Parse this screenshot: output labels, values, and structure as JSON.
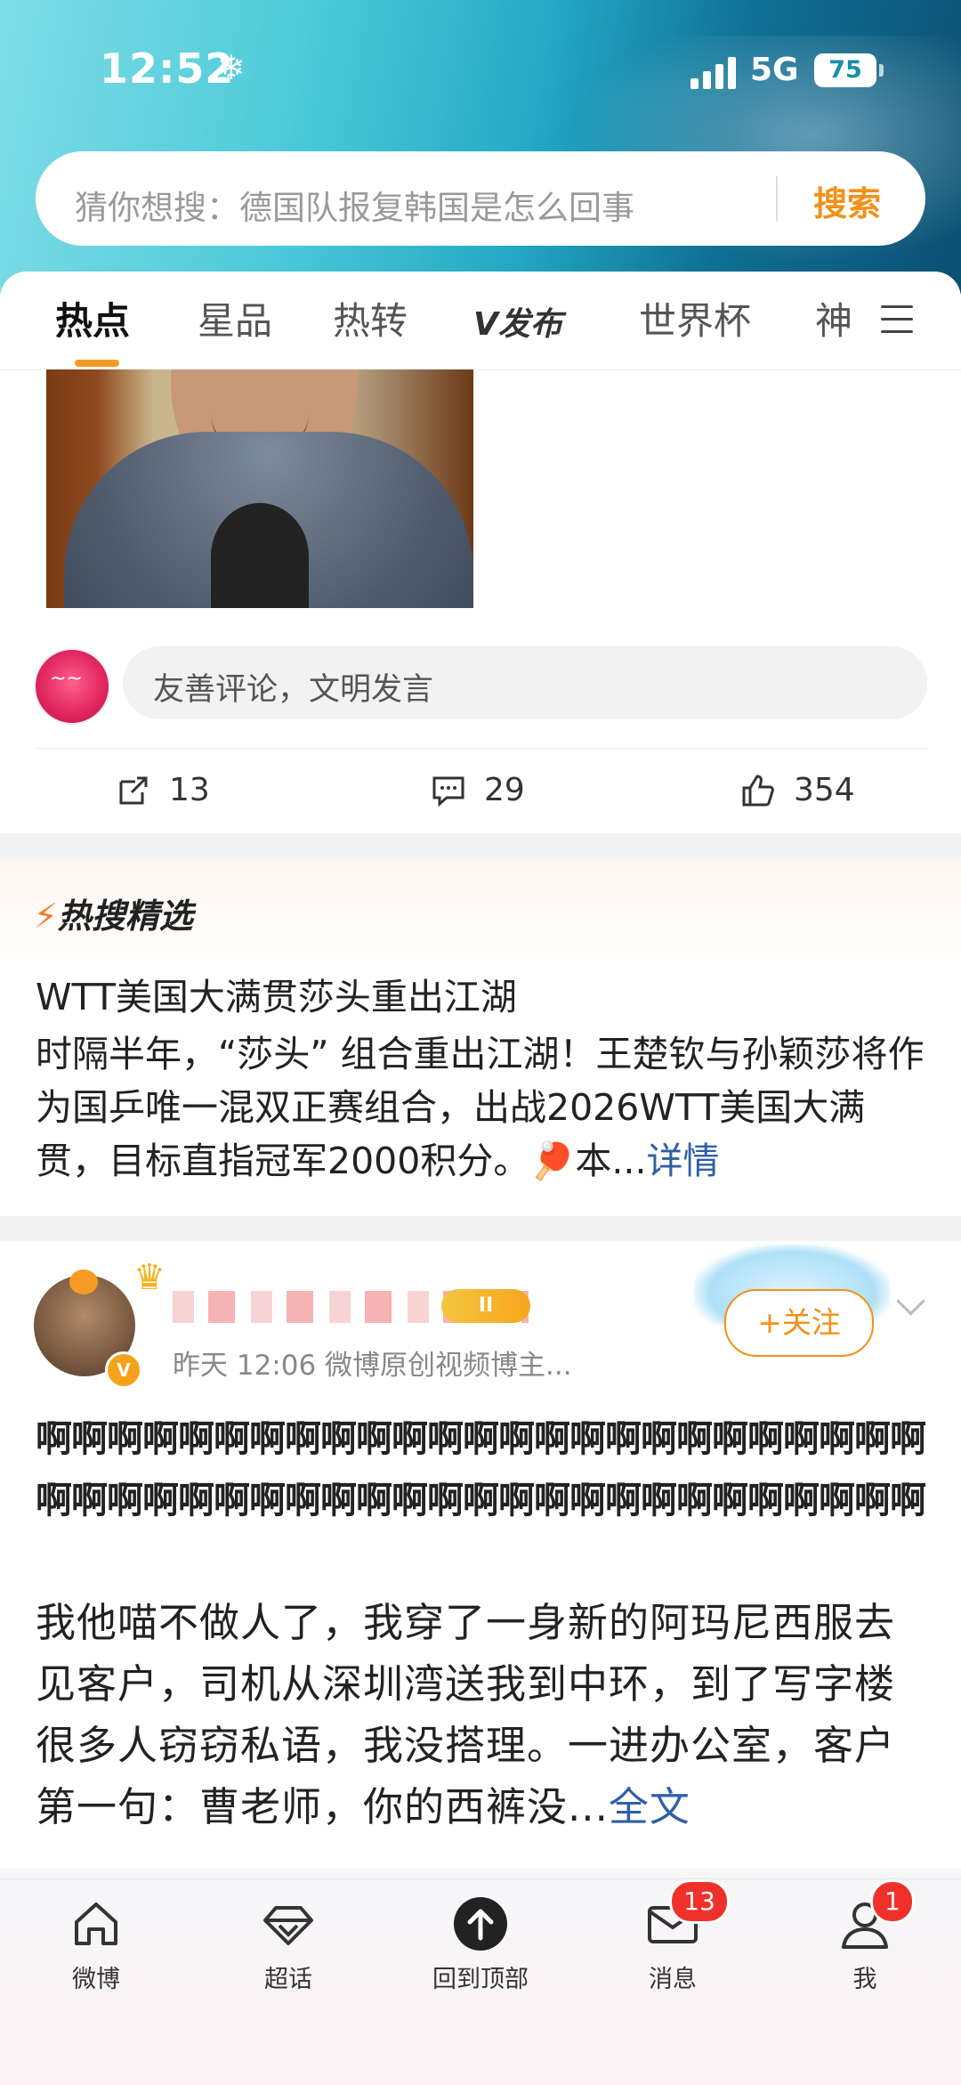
{
  "status_bar": {
    "time": "12:52",
    "network": "5G",
    "battery": "75"
  },
  "search": {
    "placeholder": "猜你想搜：德国队报复韩国是怎么回事",
    "button": "搜索"
  },
  "tabs": [
    {
      "label": "热点",
      "active": true
    },
    {
      "label": "星品"
    },
    {
      "label": "热转"
    },
    {
      "label": "V发布"
    },
    {
      "label": "世界杯"
    },
    {
      "label": "神"
    }
  ],
  "comment_box": {
    "placeholder": "友善评论，文明发言"
  },
  "post_actions": {
    "reposts": "13",
    "comments": "29",
    "likes": "354"
  },
  "hot_search": {
    "section_title": "热搜精选",
    "title": "WTT美国大满贯莎头重出江湖",
    "body": "时隔半年，“莎头” 组合重出江湖！王楚钦与孙颖莎将作为国乒唯一混双正赛组合，出战2026WTT美国大满贯，目标直指冠军2000积分。🏓本...",
    "more": "详情"
  },
  "post": {
    "level_badge": "II",
    "meta": "昨天 12:06  微博原创视频博主...",
    "follow_button": "+关注",
    "verified_badge": "V",
    "bold_text": "啊啊啊啊啊啊啊啊啊啊啊啊啊啊啊啊啊啊啊啊啊啊啊啊啊啊啊啊啊啊啊啊啊啊啊啊啊啊啊啊啊啊啊啊啊啊啊啊啊啊",
    "text": "我他喵不做人了，我穿了一身新的阿玛尼西服去见客户，司机从深圳湾送我到中环，到了写字楼很多人窃窃私语，我没搭理。一进办公室，客户第一句：曹老师，你的西裤没...",
    "more": "全文"
  },
  "bottom_nav": [
    {
      "label": "微博",
      "icon": "home-icon"
    },
    {
      "label": "超话",
      "icon": "diamond-icon"
    },
    {
      "label": "回到顶部",
      "icon": "arrow-up-icon"
    },
    {
      "label": "消息",
      "icon": "mail-icon",
      "badge": "13"
    },
    {
      "label": "我",
      "icon": "person-icon",
      "badge": "1"
    }
  ],
  "colors": {
    "accent": "#f29118",
    "link": "#2f5fa8",
    "badge": "#f0312b"
  }
}
